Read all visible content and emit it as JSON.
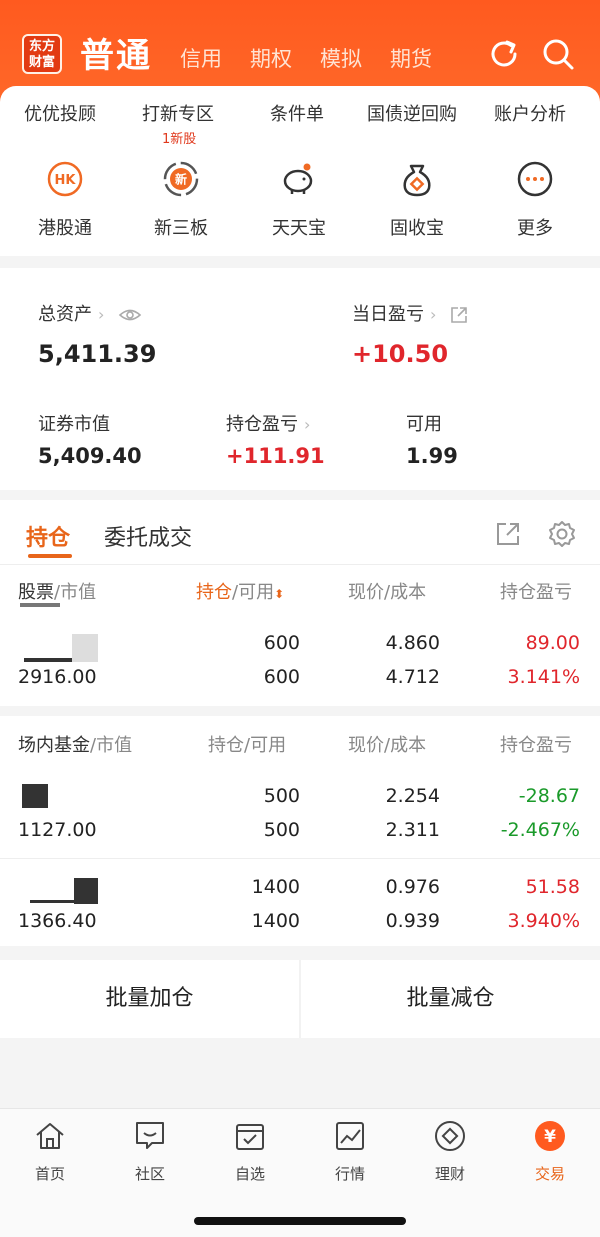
{
  "header": {
    "logo_line1": "东方",
    "logo_line2": "财富",
    "title": "普通",
    "tabs": [
      "信用",
      "期权",
      "模拟",
      "期货"
    ],
    "icons": [
      "refresh-icon",
      "search-icon"
    ]
  },
  "quick_links": [
    {
      "label": "优优投顾"
    },
    {
      "label": "打新专区",
      "badge": "1新股"
    },
    {
      "label": "条件单"
    },
    {
      "label": "国债逆回购"
    },
    {
      "label": "账户分析"
    }
  ],
  "quick_items": [
    {
      "label": "港股通",
      "icon": "hk-icon",
      "icon_text": "HK"
    },
    {
      "label": "新三板",
      "icon": "xin-icon",
      "icon_text": "新"
    },
    {
      "label": "天天宝",
      "icon": "piggy-bank-icon"
    },
    {
      "label": "固收宝",
      "icon": "money-bag-icon"
    },
    {
      "label": "更多",
      "icon": "more-icon"
    }
  ],
  "assets": {
    "total_label": "总资产",
    "total_value": "5,411.39",
    "daily_label": "当日盈亏",
    "daily_value": "+10.50",
    "market_label": "证券市值",
    "market_value": "5,409.40",
    "holding_pl_label": "持仓盈亏",
    "holding_pl_value": "+111.91",
    "available_label": "可用",
    "available_value": "1.99"
  },
  "positions": {
    "tab_holdings": "持仓",
    "tab_orders": "委托成交",
    "stock_headers": {
      "name": "股票",
      "name_sub": "/市值",
      "qty": "持仓",
      "qty_sub": "/可用",
      "price": "现价/成本",
      "pl": "持仓盈亏"
    },
    "stocks": [
      {
        "market_value": "2916.00",
        "qty": "600",
        "available": "600",
        "price": "4.860",
        "cost": "4.712",
        "pl": "89.00",
        "pl_pct": "3.141%",
        "sign": "up"
      }
    ],
    "fund_headers": {
      "name": "场内基金",
      "name_sub": "/市值",
      "qty": "持仓/可用",
      "price": "现价/成本",
      "pl": "持仓盈亏"
    },
    "funds": [
      {
        "market_value": "1127.00",
        "qty": "500",
        "available": "500",
        "price": "2.254",
        "cost": "2.311",
        "pl": "-28.67",
        "pl_pct": "-2.467%",
        "sign": "down"
      },
      {
        "market_value": "1366.40",
        "qty": "1400",
        "available": "1400",
        "price": "0.976",
        "cost": "0.939",
        "pl": "51.58",
        "pl_pct": "3.940%",
        "sign": "up"
      }
    ]
  },
  "batch": {
    "add": "批量加仓",
    "reduce": "批量减仓"
  },
  "nav": [
    {
      "label": "首页",
      "icon": "home-icon"
    },
    {
      "label": "社区",
      "icon": "community-icon"
    },
    {
      "label": "自选",
      "icon": "watchlist-icon"
    },
    {
      "label": "行情",
      "icon": "market-chart-icon"
    },
    {
      "label": "理财",
      "icon": "wealth-icon"
    },
    {
      "label": "交易",
      "icon": "trade-yuan-icon",
      "active": true,
      "glyph": "¥"
    }
  ],
  "colors": {
    "brand": "#ff5a1f",
    "accent": "#e8651a",
    "up": "#e0262c",
    "down": "#1a9a2a"
  }
}
